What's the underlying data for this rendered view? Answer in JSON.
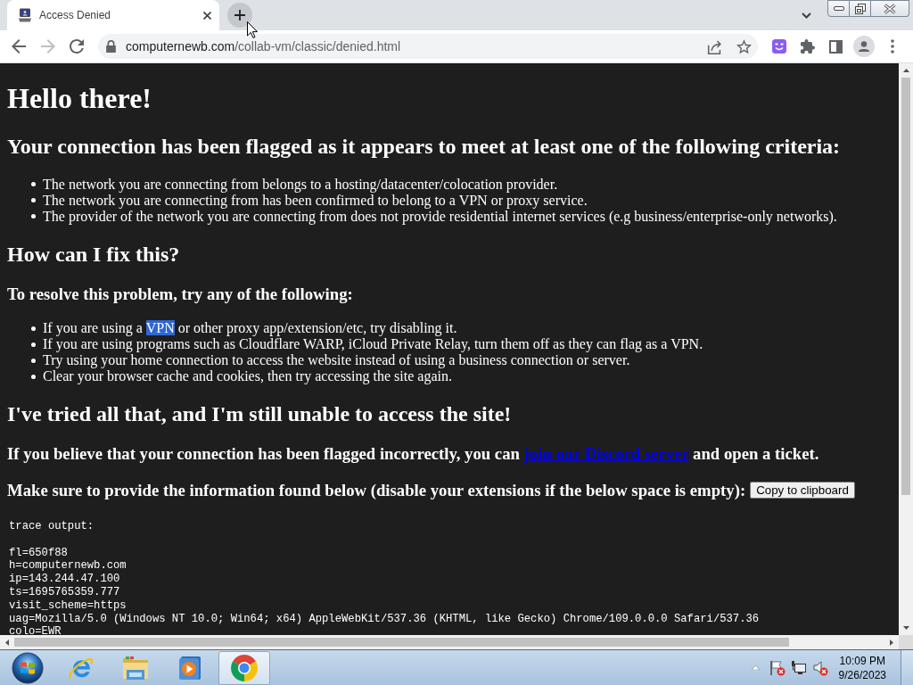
{
  "browser": {
    "tabs": [
      {
        "title": "Access Denied",
        "selected": true
      }
    ],
    "navigation": {
      "back": {
        "disabled": false
      },
      "forward": {
        "disabled": true
      }
    },
    "address_bar": {
      "domain": "computernewb.com",
      "path": "/collab-vm/classic/denied.html"
    }
  },
  "page": {
    "title": "Hello there!",
    "heading": "Your connection has been flagged as it appears to meet at least one of the following criteria:",
    "criteria": [
      "The network you are connecting from belongs to a hosting/datacenter/colocation provider.",
      "The network you are connecting from has been confirmed to belong to a VPN or proxy service.",
      "The provider of the network you are connecting from does not provide residential internet services (e.g business/enterprise-only networks)."
    ],
    "fix_heading": "How can I fix this?",
    "fix_intro": "To resolve this problem, try any of the following:",
    "fixes": [
      {
        "segments": [
          {
            "text": "If you are using a ",
            "selected": false
          },
          {
            "text": "VPN",
            "selected": true
          },
          {
            "text": " or other proxy app/extension/etc, try disabling it.",
            "selected": false
          }
        ]
      },
      {
        "segments": [
          {
            "text": "If you are using programs such as Cloudflare WARP, iCloud Private Relay, turn them off as they can flag as a VPN.",
            "selected": false
          }
        ]
      },
      {
        "segments": [
          {
            "text": "Try using your home connection to access the website instead of using a business connection or server.",
            "selected": false
          }
        ]
      },
      {
        "segments": [
          {
            "text": "Clear your browser cache and cookies, then try accessing the site again.",
            "selected": false
          }
        ]
      }
    ],
    "support_heading": "I've tried all that, and I'm still unable to access the site!",
    "support_text": {
      "before": "If you believe that your connection has been flagged incorrectly, you can ",
      "link": "join our Discord server",
      "after": " and open a ticket."
    },
    "info_text": "Make sure to provide the information found below (disable your extensions if the below space is empty):",
    "copy_button": "Copy to clipboard",
    "trace_label": "trace output:",
    "trace_lines": [
      "fl=650f88",
      "h=computernewb.com",
      "ip=143.244.47.100",
      "ts=1695765359.777",
      "visit_scheme=https",
      "uag=Mozilla/5.0 (Windows NT 10.0; Win64; x64) AppleWebKit/537.36 (KHTML, like Gecko) Chrome/109.0.0.0 Safari/537.36",
      "colo=EWR"
    ]
  },
  "taskbar": {
    "apps": [
      {
        "kind": "internet-explorer",
        "selected": false
      },
      {
        "kind": "file-explorer",
        "selected": false
      },
      {
        "kind": "media-player",
        "selected": false
      },
      {
        "kind": "chrome",
        "selected": true
      }
    ],
    "tray": [
      {
        "kind": "flag",
        "alert": true
      },
      {
        "kind": "network",
        "alert": false
      },
      {
        "kind": "speaker",
        "alert": true
      }
    ],
    "clock": {
      "time": "10:09 PM",
      "date": "9/26/2023"
    }
  }
}
